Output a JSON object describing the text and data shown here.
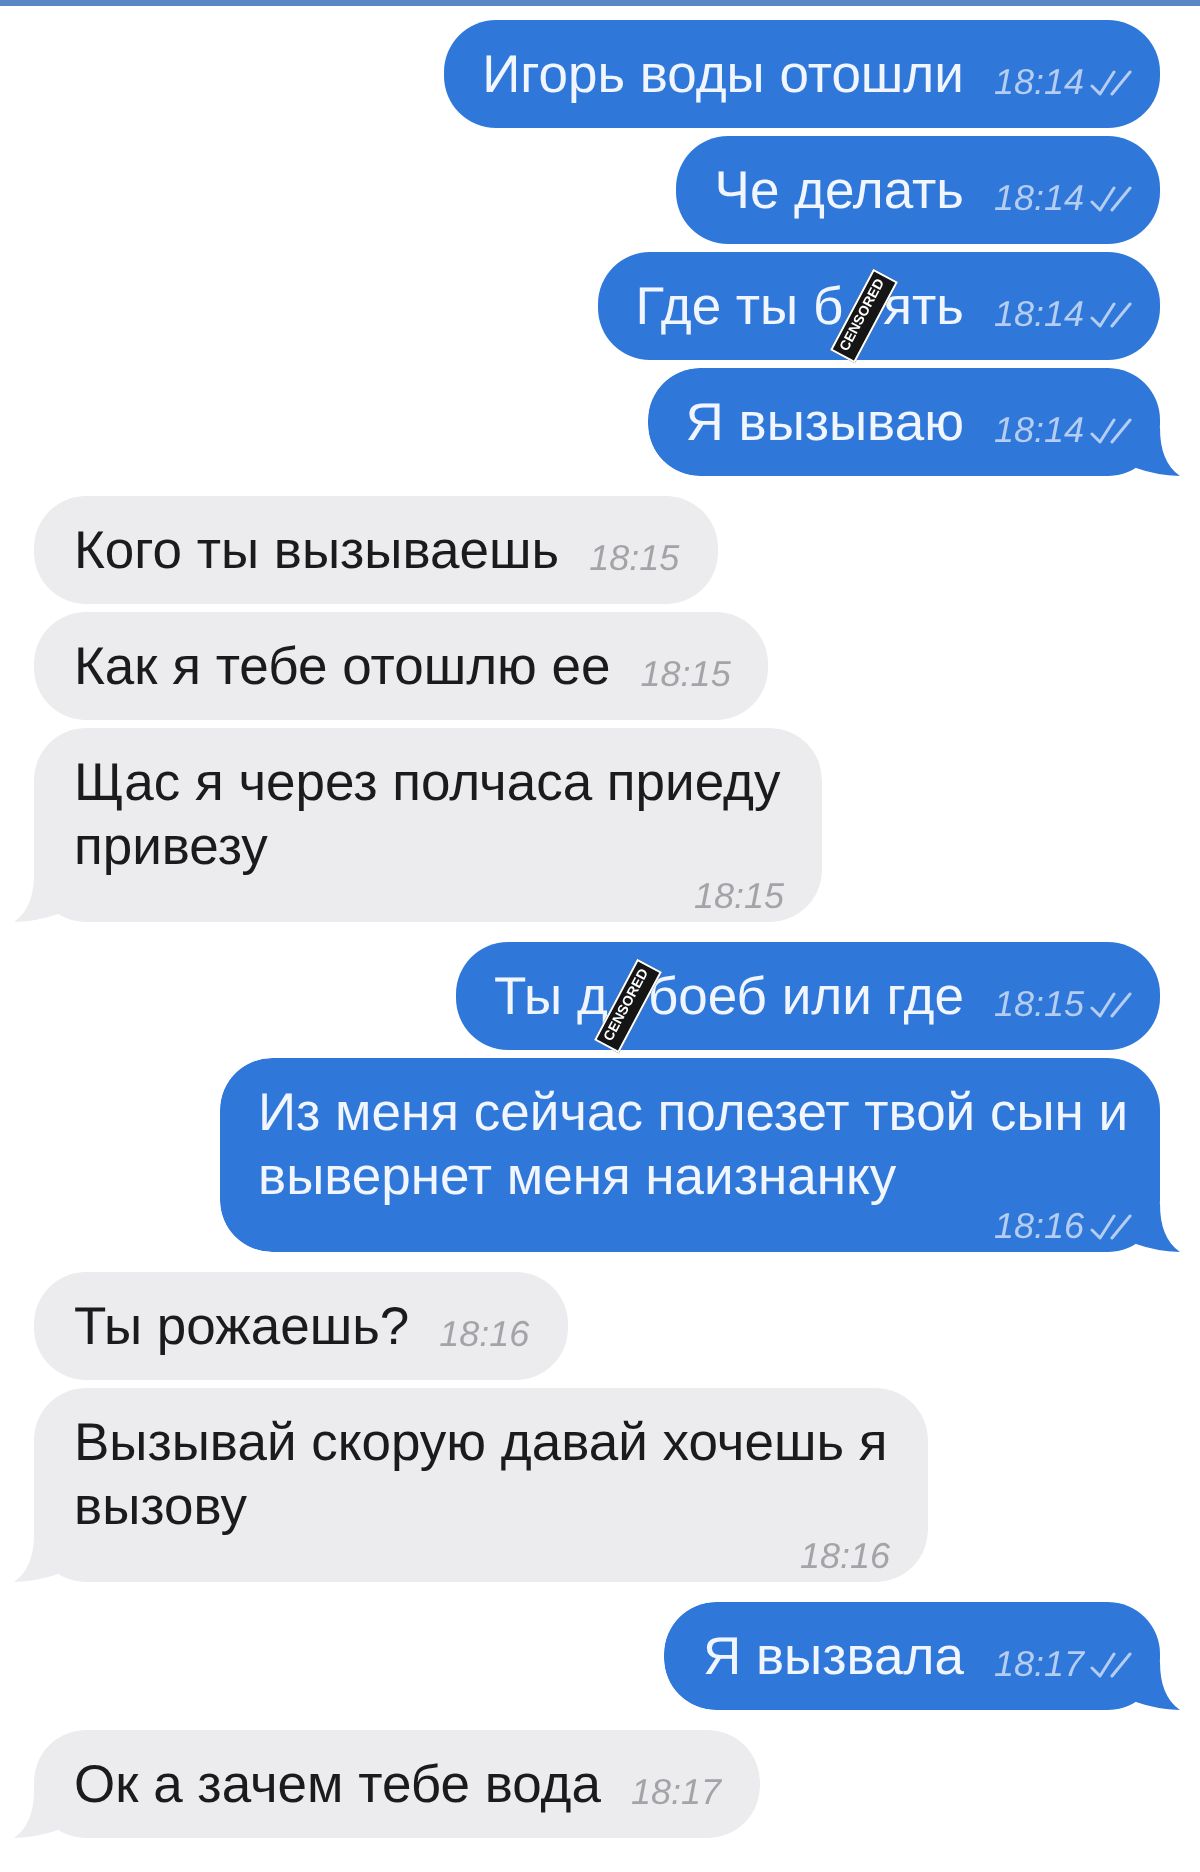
{
  "messages": [
    {
      "kind": "outgoing",
      "text": "Игорь воды отошли",
      "time": "18:14",
      "read": true,
      "tail": false
    },
    {
      "kind": "outgoing",
      "text": "Че делать",
      "time": "18:14",
      "read": true,
      "tail": false
    },
    {
      "kind": "outgoing",
      "parts": [
        {
          "kind": "text",
          "text": "Где ты б"
        },
        {
          "kind": "sticker",
          "text": "CENSORED"
        },
        {
          "kind": "text",
          "text": "ять"
        }
      ],
      "time": "18:14",
      "read": true,
      "tail": false
    },
    {
      "kind": "outgoing",
      "text": "Я вызываю",
      "time": "18:14",
      "read": true,
      "tail": true
    },
    {
      "kind": "incoming",
      "text": "Кого ты вызываешь",
      "time": "18:15",
      "tail": false
    },
    {
      "kind": "incoming",
      "text": "Как я тебе отошлю ее",
      "time": "18:15",
      "tail": false
    },
    {
      "kind": "incoming",
      "text": "Щас я через полчаса приеду привезу",
      "time": "18:15",
      "tail": true
    },
    {
      "kind": "outgoing",
      "parts": [
        {
          "kind": "text",
          "text": "Ты д"
        },
        {
          "kind": "sticker",
          "text": "CENSORED"
        },
        {
          "kind": "text",
          "text": "боеб или где"
        }
      ],
      "time": "18:15",
      "read": true,
      "tail": false
    },
    {
      "kind": "outgoing",
      "text": "Из меня сейчас полезет твой сын и вывернет меня наизнанку",
      "time": "18:16",
      "read": true,
      "tail": true
    },
    {
      "kind": "incoming",
      "text": "Ты рожаешь?",
      "time": "18:16",
      "tail": false
    },
    {
      "kind": "incoming",
      "text": "Вызывай скорую давай хочешь я вызову",
      "time": "18:16",
      "tail": true
    },
    {
      "kind": "outgoing",
      "text": "Я вызвала",
      "time": "18:17",
      "read": true,
      "tail": true
    },
    {
      "kind": "incoming",
      "text": "Ок а зачем тебе вода",
      "time": "18:17",
      "tail": true
    }
  ]
}
